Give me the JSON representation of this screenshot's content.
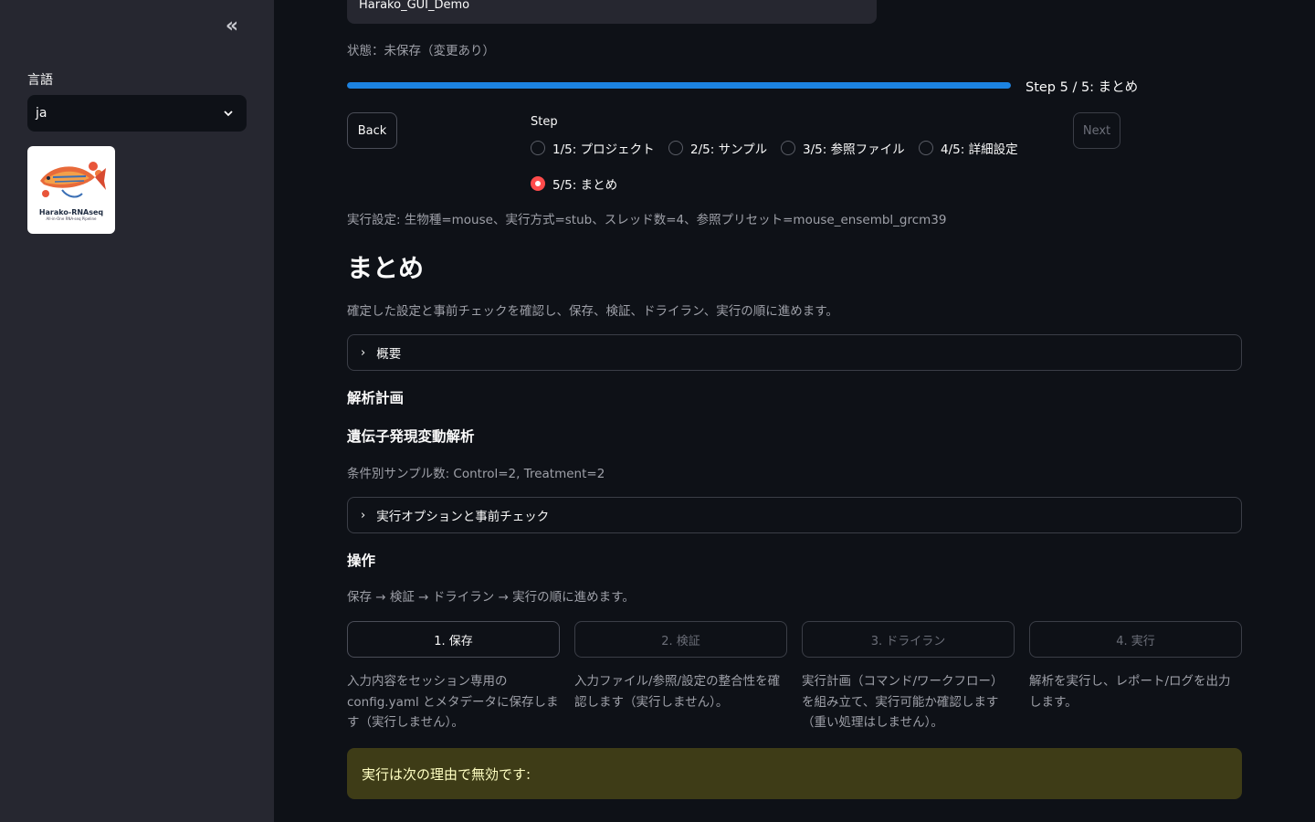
{
  "sidebar": {
    "collapse_icon": "«",
    "language_label": "言語",
    "language_value": "ja",
    "logo": {
      "title": "Harako-RNAseq",
      "subtitle": "All-in-One RNA-seq Pipeline"
    }
  },
  "project": {
    "name_value": "Harako_GUI_Demo"
  },
  "status": "状態：未保存（変更あり）",
  "progress": {
    "fraction": 1.0,
    "label": "Step 5 / 5: まとめ"
  },
  "nav": {
    "back": "Back",
    "next": "Next"
  },
  "steps": {
    "label": "Step",
    "options": [
      "1/5: プロジェクト",
      "2/5: サンプル",
      "3/5: 参照ファイル",
      "4/5: 詳細設定",
      "5/5: まとめ"
    ],
    "selected_index": 4
  },
  "exec_settings": "実行設定: 生物種=mouse、実行方式=stub、スレッド数=4、参照プリセット=mouse_ensembl_grcm39",
  "summary": {
    "heading": "まとめ",
    "description": "確定した設定と事前チェックを確認し、保存、検証、ドライラン、実行の順に進めます。"
  },
  "expanders": {
    "overview": "概要",
    "options_checks": "実行オプションと事前チェック"
  },
  "plan": {
    "heading": "解析計画",
    "subheading": "遺伝子発現変動解析",
    "condition_counts": "条件別サンプル数: Control=2, Treatment=2"
  },
  "operations": {
    "heading": "操作",
    "description": "保存 → 検証 → ドライラン → 実行の順に進めます。",
    "buttons": [
      {
        "label": "1. 保存",
        "desc": "入力内容をセッション専用の config.yaml とメタデータに保存します（実行しません）。"
      },
      {
        "label": "2. 検証",
        "desc": "入力ファイル/参照/設定の整合性を確認します（実行しません）。"
      },
      {
        "label": "3. ドライラン",
        "desc": "実行計画（コマンド/ワークフロー）を組み立て、実行可能か確認します（重い処理はしません）。"
      },
      {
        "label": "4. 実行",
        "desc": "解析を実行し、レポート/ログを出力します。"
      }
    ]
  },
  "warning": "実行は次の理由で無効です:",
  "colors": {
    "accent": "#1c83e1",
    "radio_selected": "#ff4b4b",
    "warning_bg": "#3e3c17",
    "warning_text": "#ffffc2"
  }
}
